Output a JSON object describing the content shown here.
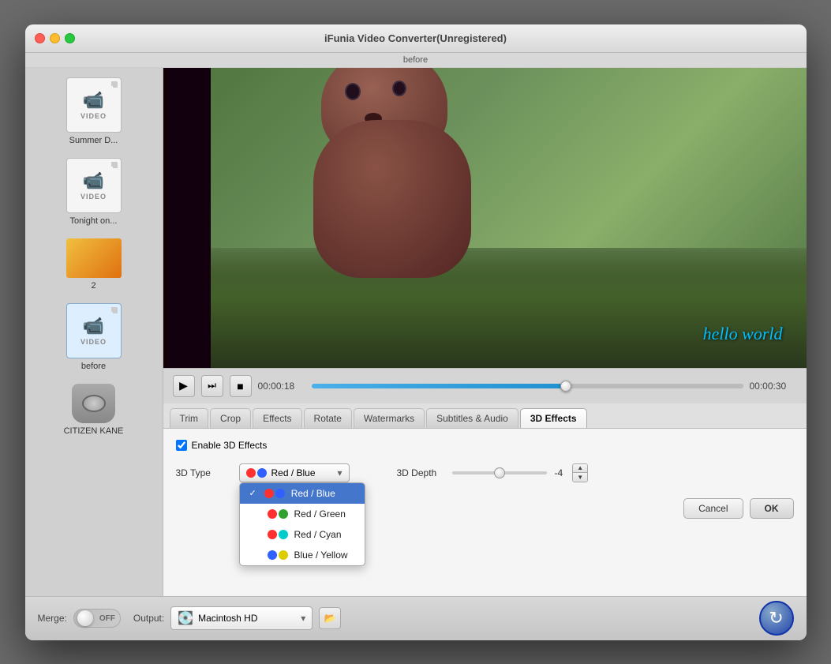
{
  "window": {
    "title": "iFunia Video Converter(Unregistered)",
    "subtitle": "before"
  },
  "sidebar": {
    "items": [
      {
        "id": "summer",
        "label": "Summer D...",
        "type": "video"
      },
      {
        "id": "tonight",
        "label": "Tonight on...",
        "type": "video"
      },
      {
        "id": "item3",
        "label": "2",
        "type": "thumb"
      },
      {
        "id": "before",
        "label": "before",
        "type": "video",
        "selected": true
      },
      {
        "id": "citizen",
        "label": "CITIZEN KANE",
        "type": "disk"
      }
    ]
  },
  "preview": {
    "overlay_text": "hello world"
  },
  "controls": {
    "time_current": "00:00:18",
    "time_total": "00:00:30",
    "progress_percent": 60
  },
  "tabs": {
    "items": [
      {
        "id": "trim",
        "label": "Trim"
      },
      {
        "id": "crop",
        "label": "Crop"
      },
      {
        "id": "effects",
        "label": "Effects"
      },
      {
        "id": "rotate",
        "label": "Rotate"
      },
      {
        "id": "watermarks",
        "label": "Watermarks"
      },
      {
        "id": "subtitles",
        "label": "Subtitles & Audio"
      },
      {
        "id": "3deffects",
        "label": "3D Effects",
        "active": true
      }
    ]
  },
  "panel_3d": {
    "enable_label": "Enable 3D Effects",
    "type_label": "3D Type",
    "depth_label": "3D Depth",
    "depth_value": "-4",
    "dropdown": {
      "selected": "Red / Blue",
      "options": [
        {
          "id": "red_blue",
          "label": "Red / Blue",
          "selected": true
        },
        {
          "id": "red_green",
          "label": "Red / Green"
        },
        {
          "id": "red_cyan",
          "label": "Red / Cyan"
        },
        {
          "id": "blue_yellow",
          "label": "Blue / Yellow"
        }
      ]
    }
  },
  "buttons": {
    "cancel": "Cancel",
    "ok": "OK"
  },
  "bottom_bar": {
    "merge_label": "Merge:",
    "toggle_label": "OFF",
    "output_label": "Output:",
    "output_value": "Macintosh HD"
  }
}
